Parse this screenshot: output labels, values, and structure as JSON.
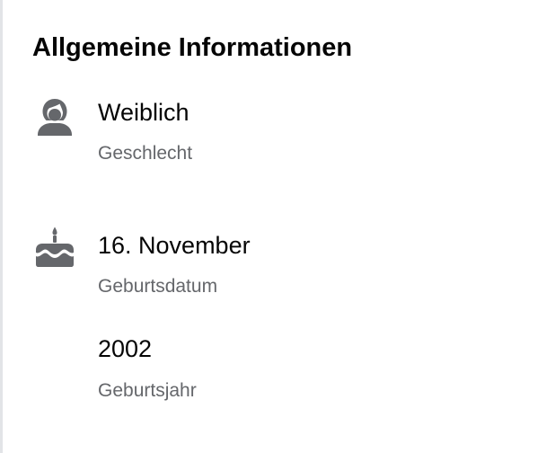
{
  "section": {
    "title": "Allgemeine Informationen"
  },
  "items": [
    {
      "icon": "female-person-icon",
      "value": "Weiblich",
      "label": "Geschlecht"
    },
    {
      "icon": "birthday-cake-icon",
      "value": "16. November",
      "label": "Geburtsdatum"
    },
    {
      "icon": "",
      "value": "2002",
      "label": "Geburtsjahr"
    }
  ],
  "colors": {
    "text_primary": "#050505",
    "text_secondary": "#65676b",
    "icon": "#65676b",
    "border": "#e2e4e7",
    "background": "#ffffff"
  }
}
